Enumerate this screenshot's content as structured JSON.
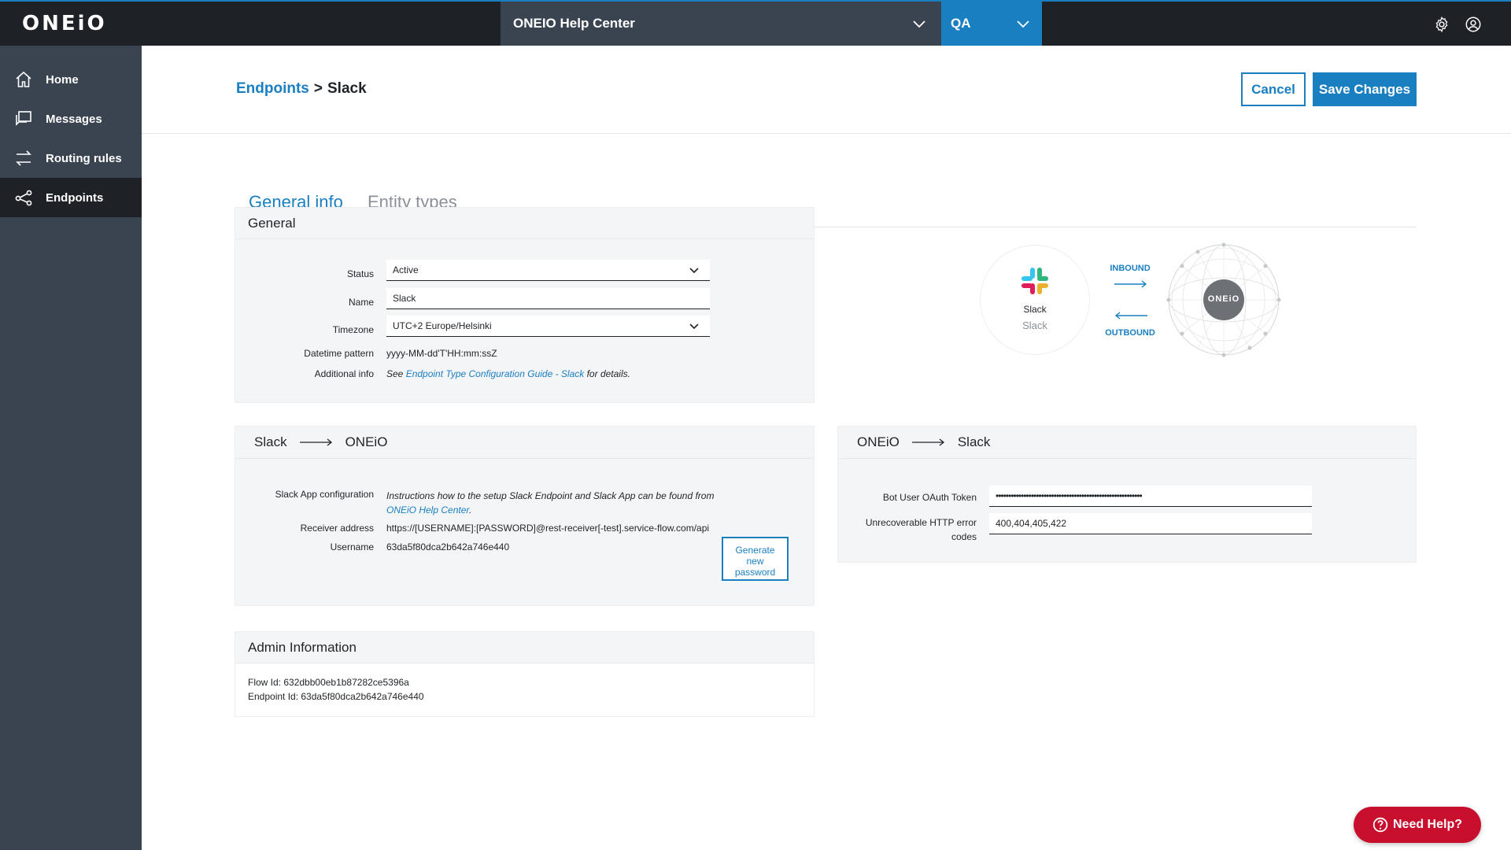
{
  "topbar": {
    "logo_text": "ONEiO",
    "org_select": "ONEIO Help Center",
    "env_select": "QA"
  },
  "sidebar": {
    "items": [
      {
        "label": "Home",
        "icon": "home-icon"
      },
      {
        "label": "Messages",
        "icon": "messages-icon"
      },
      {
        "label": "Routing rules",
        "icon": "routing-icon"
      },
      {
        "label": "Endpoints",
        "icon": "endpoints-icon",
        "active": true
      }
    ]
  },
  "header": {
    "breadcrumb_parent": "Endpoints",
    "breadcrumb_sep": ">",
    "breadcrumb_current": "Slack",
    "cancel_label": "Cancel",
    "save_label": "Save Changes"
  },
  "tabs": [
    {
      "label": "General info",
      "active": true
    },
    {
      "label": "Entity types",
      "active": false
    }
  ],
  "general": {
    "title": "General",
    "status_label": "Status",
    "status_value": "Active",
    "name_label": "Name",
    "name_value": "Slack",
    "timezone_label": "Timezone",
    "timezone_value": "UTC+2 Europe/Helsinki",
    "datetime_label": "Datetime pattern",
    "datetime_value": "yyyy-MM-dd'T'HH:mm:ssZ",
    "additional_label": "Additional info",
    "additional_pre": "See ",
    "additional_link": "Endpoint Type Configuration Guide - Slack",
    "additional_post": " for details."
  },
  "diagram": {
    "endpoint_name": "Slack",
    "endpoint_type": "Slack",
    "inbound": "INBOUND",
    "outbound": "OUTBOUND",
    "hub_logo": "ONEiO"
  },
  "inbound_panel": {
    "from": "Slack",
    "to": "ONEiO",
    "app_config_label": "Slack App configuration",
    "app_config_text": "Instructions how to the setup Slack Endpoint and Slack App can be found from",
    "app_config_link": "ONEiO Help Center",
    "app_config_end": ".",
    "receiver_label": "Receiver address",
    "receiver_value": "https://[USERNAME]:[PASSWORD]@rest-receiver[-test].service-flow.com/api",
    "username_label": "Username",
    "username_value": "63da5f80dca2b642a746e440",
    "generate_line1": "Generate",
    "generate_line2": "new",
    "generate_line3": "password"
  },
  "outbound_panel": {
    "from": "ONEiO",
    "to": "Slack",
    "token_label": "Bot User OAuth Token",
    "token_value": "••••••••••••••••••••••••••••••••••••••••••••••••••••••••••",
    "http_label_line1": "Unrecoverable HTTP error",
    "http_label_line2": "codes",
    "http_value": "400,404,405,422"
  },
  "admin": {
    "title": "Admin Information",
    "flow_id": "Flow Id: 632dbb00eb1b87282ce5396a",
    "endpoint_id": "Endpoint Id: 63da5f80dca2b642a746e440"
  },
  "help_button": {
    "label": "Need Help?"
  },
  "colors": {
    "accent": "#1a7fc1",
    "topbar": "#1e2227",
    "sidebar": "#3a4350",
    "help": "#c8102e"
  }
}
